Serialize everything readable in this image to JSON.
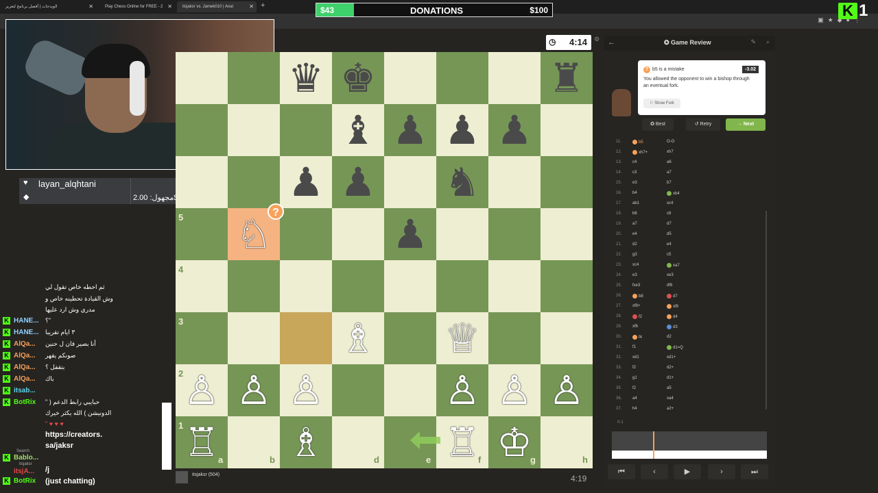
{
  "browser": {
    "tabs": [
      {
        "label": "الويدجات | أفضل برنامج لتعزيز"
      },
      {
        "label": "Play Chess Online for FREE - 2"
      },
      {
        "label": "itsjaksr vs. Jamek010 | Anal"
      }
    ]
  },
  "donations": {
    "start": "$43",
    "title": "DONATIONS",
    "end": "$100",
    "progress": 0.16
  },
  "kick": {
    "logo": "K",
    "count": "1"
  },
  "donor": {
    "name": "layan_alqhtani",
    "amount": "مجهول: 2.00$",
    "dollar": "$"
  },
  "chat": {
    "lines": [
      {
        "user": "",
        "msg": "ثم احطه خاص تقول لي"
      },
      {
        "user": "",
        "msg": "وش القيادة تحطينه خاص و"
      },
      {
        "user": "",
        "msg": "مدري وش ارد عليها"
      },
      {
        "user": "HANE...",
        "msg": "\"؟"
      },
      {
        "user": "HANE...",
        "msg": "٣ ايام تقريبا"
      },
      {
        "user": "AlQa...",
        "msg": "أنا بصير فان ل حنين"
      },
      {
        "user": "AlQa...",
        "msg": "صونكم يقهر"
      },
      {
        "user": "AlQa...",
        "msg": "بتقفل ؟"
      },
      {
        "user": "AlQa...",
        "msg": "باك"
      },
      {
        "user": "itsab...",
        "msg": ""
      },
      {
        "user": "BotRix",
        "msg": "حبايبي رابط الدعم ( \""
      },
      {
        "user": "",
        "msg": "الدونيشن ) الله يكثر خيرك"
      },
      {
        "user": "",
        "msg": "\""
      },
      {
        "user": "",
        "msg": "https://creators."
      },
      {
        "user": "",
        "msg": "sa/jaksr"
      },
      {
        "user": "Bablo...",
        "msg": ""
      },
      {
        "user": "itsjA...",
        "msg": "/j"
      },
      {
        "user": "BotRix",
        "msg": "(just chatting)"
      }
    ],
    "search": "Search",
    "search_user": "itsjaksr"
  },
  "game": {
    "clock_top": "4:14",
    "clock_bottom": "4:19",
    "player_bottom": "itsjaksr (504)",
    "files": [
      "a",
      "b",
      "d",
      "e",
      "f",
      "g",
      "h"
    ],
    "ranks": [
      "5",
      "4",
      "3",
      "2",
      "1"
    ],
    "mistake_badge": "?"
  },
  "review": {
    "title": "Game Review",
    "mistake_title": "b5 is a mistake",
    "score": "-3.02",
    "desc": "You allowed the opponent to win a bishop through an eventual fork.",
    "show_fork": "Show Fork",
    "best": "Best",
    "retry": "Retry",
    "next": "Next",
    "moves": [
      {
        "n": "11.",
        "w": "b5",
        "b": "O-O",
        "wc": "#f7a15a"
      },
      {
        "n": "12.",
        "w": "xh7+",
        "b": "xh7",
        "wc": "#f7a15a"
      },
      {
        "n": "13.",
        "w": "c4",
        "b": "a6"
      },
      {
        "n": "14.",
        "w": "c3",
        "b": "a7"
      },
      {
        "n": "15.",
        "w": "e3",
        "b": "b7"
      },
      {
        "n": "16.",
        "w": "b4",
        "b": "xb4",
        "bc": "#81b64c"
      },
      {
        "n": "17.",
        "w": "ab1",
        "b": "xc4"
      },
      {
        "n": "18.",
        "w": "b6",
        "b": "c8"
      },
      {
        "n": "19.",
        "w": "a7",
        "b": "d7"
      },
      {
        "n": "20.",
        "w": "e4",
        "b": "d5"
      },
      {
        "n": "21.",
        "w": "d2",
        "b": "e4"
      },
      {
        "n": "22.",
        "w": "g3",
        "b": "c5"
      },
      {
        "n": "23.",
        "w": "xc4",
        "b": "xa7",
        "bc": "#81b64c"
      },
      {
        "n": "24.",
        "w": "e3",
        "b": "xe3"
      },
      {
        "n": "25.",
        "w": "fxe3",
        "b": "df6"
      },
      {
        "n": "26.",
        "w": "b8",
        "b": "d7",
        "wc": "#f7a15a",
        "bc": "#e05050"
      },
      {
        "n": "27.",
        "w": "xf8+",
        "b": "xf8",
        "bc": "#f7a15a"
      },
      {
        "n": "28.",
        "w": "f2",
        "b": "d4",
        "wc": "#e05050",
        "bc": "#f7a15a"
      },
      {
        "n": "29.",
        "w": "xf6",
        "b": "d3",
        "bc": "#5b8fd6"
      },
      {
        "n": "30.",
        "w": "f4",
        "b": "d2",
        "wc": "#f7a15a"
      },
      {
        "n": "31.",
        "w": "f1",
        "b": "d1=Q",
        "bc": "#81b64c"
      },
      {
        "n": "32.",
        "w": "xd1",
        "b": "xd1+"
      },
      {
        "n": "33.",
        "w": "f2",
        "b": "d2+"
      },
      {
        "n": "34.",
        "w": "g1",
        "b": "d1+"
      },
      {
        "n": "35.",
        "w": "f2",
        "b": "a5"
      },
      {
        "n": "36.",
        "w": "a4",
        "b": "xa4"
      },
      {
        "n": "37.",
        "w": "h4",
        "b": "a2+"
      }
    ],
    "result": "0-1"
  },
  "colors": {
    "light": "#eeeed2",
    "dark": "#769656",
    "accent": "#81b64c",
    "mistake": "#f7a15a"
  }
}
